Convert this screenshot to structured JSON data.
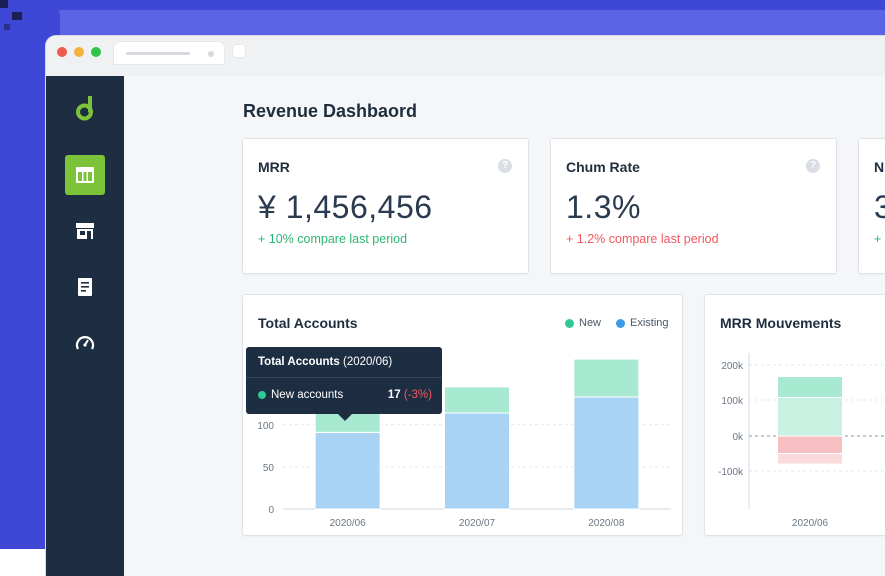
{
  "colors": {
    "accent_green": "#7cc33a",
    "sidebar_bg": "#1e2e42",
    "positive": "#2bb673",
    "negative": "#f0585e",
    "series_new": "#2ec995",
    "series_existing": "#3d9cea"
  },
  "sidebar": {
    "logo_icon": "leaf-d-logo",
    "items": [
      {
        "icon": "table-icon",
        "active": true
      },
      {
        "icon": "store-icon",
        "active": false
      },
      {
        "icon": "receipt-icon",
        "active": false
      },
      {
        "icon": "gauge-icon",
        "active": false
      }
    ]
  },
  "page": {
    "title": "Revenue Dashbaord"
  },
  "kpis": [
    {
      "label": "MRR",
      "value": "¥ 1,456,456",
      "delta": "+ 10% compare last period",
      "trend": "positive"
    },
    {
      "label": "Chum Rate",
      "value": "1.3%",
      "delta": "+ 1.2% compare last period",
      "trend": "negative"
    },
    {
      "label": "N",
      "value": "3",
      "delta": "+ ",
      "trend": "positive"
    }
  ],
  "total_accounts": {
    "title": "Total Accounts",
    "legend": [
      {
        "label": "New",
        "color": "#2ec995"
      },
      {
        "label": "Existing",
        "color": "#3d9cea"
      }
    ],
    "tooltip": {
      "title": "Total Accounts",
      "period": "(2020/06)",
      "row_label": "New accounts",
      "row_value": "17",
      "row_change": "(-3%)"
    }
  },
  "mrr_movements": {
    "title": "MRR Mouvements"
  },
  "chart_data": [
    {
      "type": "bar",
      "stacked": true,
      "title": "Total Accounts",
      "categories": [
        "2020/06",
        "2020/07",
        "2020/08"
      ],
      "series": [
        {
          "name": "Existing",
          "values": [
            91,
            114,
            133
          ]
        },
        {
          "name": "New",
          "values": [
            36,
            31,
            45
          ]
        }
      ],
      "yticks": [
        0,
        50,
        100
      ],
      "ylim": [
        0,
        190
      ],
      "grid": true,
      "legend": "top-right"
    },
    {
      "type": "bar",
      "stacked": true,
      "title": "MRR Mouvements",
      "categories": [
        "2020/06"
      ],
      "series": [
        {
          "values": [
            110
          ]
        },
        {
          "values": [
            60
          ]
        },
        {
          "values": [
            -50
          ]
        },
        {
          "values": [
            -30
          ]
        }
      ],
      "yticks": [
        "200k",
        "100k",
        "0k",
        "-100k"
      ],
      "ylim": [
        -200,
        250
      ],
      "grid": true
    }
  ]
}
